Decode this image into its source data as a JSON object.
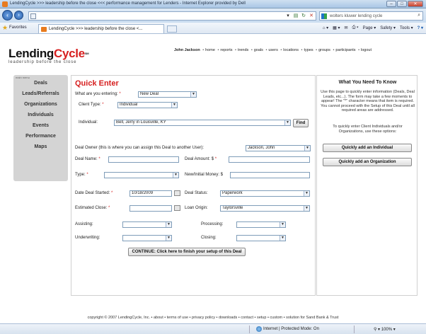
{
  "window": {
    "title": "LendingCycle >>> leadership before the close <<< performance management for Lenders - Internet Explorer provided by Dell"
  },
  "browser": {
    "search_value": "wolters kluwer lending cycle",
    "favorites_label": "Favorites",
    "tab_label": "LendingCycle >>> leadership before the close <...",
    "commands": [
      "Page ▾",
      "Safety ▾",
      "Tools ▾"
    ]
  },
  "site": {
    "logo_lending": "Lending",
    "logo_cycle": "Cycle",
    "logo_sm": "SM",
    "tagline": "leadership before the close",
    "user": "John Jackson",
    "topnav": [
      "home",
      "reports",
      "trends",
      "goals",
      "users",
      "locations",
      "types",
      "groups",
      "participants",
      "logout"
    ]
  },
  "sidebar": {
    "header": "main menu",
    "items": [
      "Deals",
      "Leads/Referrals",
      "Organizations",
      "Individuals",
      "Events",
      "Performance",
      "Maps"
    ]
  },
  "form": {
    "title": "Quick Enter",
    "entering_label": "What are you entering:",
    "entering_value": "New Deal",
    "client_type_label": "Client Type:",
    "client_type_value": "Individual",
    "individual_label": "Individual:",
    "individual_value": "Bell, Jerry in Louisville, KY",
    "find_label": "Find",
    "owner_label": "Deal Owner (this is where you can assign this Deal to another User):",
    "owner_value": "Jackson, John",
    "deal_name_label": "Deal Name:",
    "deal_name_value": "",
    "deal_amount_label": "Deal Amount: $",
    "deal_amount_value": "",
    "type_label": "Type:",
    "type_value": "",
    "new_money_label": "New/Initial Money: $",
    "new_money_value": "",
    "date_started_label": "Date Deal Started:",
    "date_started_value": "10/18/2009",
    "status_label": "Deal Status:",
    "status_value": "Paperwork",
    "est_close_label": "Estimated Close:",
    "est_close_value": "",
    "loan_origin_label": "Loan Origin:",
    "loan_origin_value": "Taylorsville",
    "assisting_label": "Assisting:",
    "assisting_value": "",
    "processing_label": "Processing:",
    "processing_value": "",
    "underwriting_label": "Underwriting:",
    "underwriting_value": "",
    "closing_label": "Closing:",
    "closing_value": "",
    "required_marker": "*",
    "continue_label": "CONTINUE: Click here to finish your setup of this Deal"
  },
  "panel": {
    "title": "What You Need To Know",
    "text1": "Use this page to quickly enter information (Deals, Deal Leads, etc...). The form may take a few moments to appear! The \"*\" character means that item is required. You cannot proceed with the Setup of this Deal until all required areas are addressed.",
    "text2": "To quickly enter Client Individuals and/or Organizations, use these options:",
    "btn_individual": "Quickly add an Individual",
    "btn_organization": "Quickly add an Organization"
  },
  "footer": "copyright © 2007 LendingCycle, Inc. • about • terms of use • privacy policy • downloads • contact • setup • custom • solution for Sand Bank & Trust",
  "status": {
    "zone": "Internet | Protected Mode: On",
    "zoom": "100%"
  }
}
